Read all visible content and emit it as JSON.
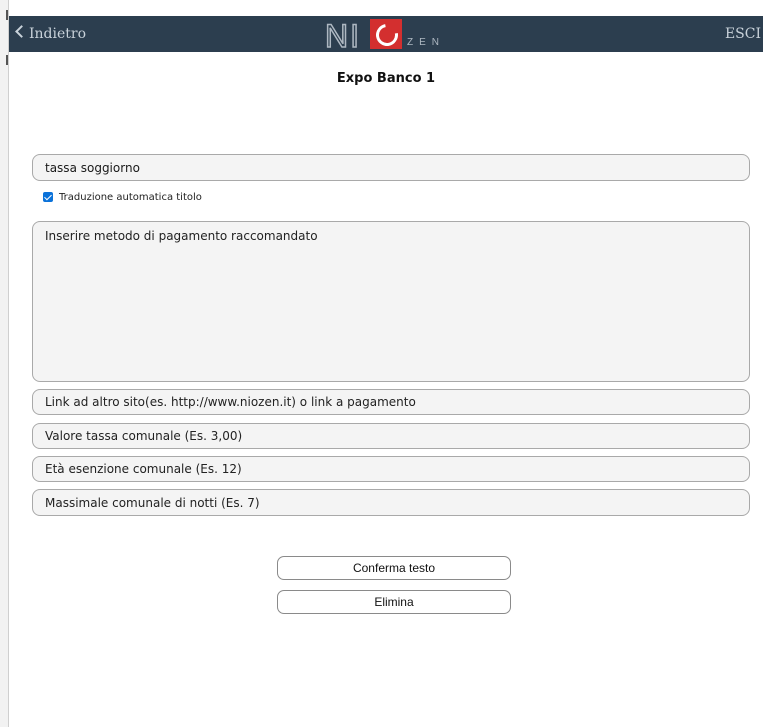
{
  "header": {
    "back_label": "Indietro",
    "logo_text_left": "NI",
    "logo_text_small": "ZEN",
    "exit_label": "ESCI",
    "bar_color": "#2c3e4f",
    "accent_color": "#d32f2f"
  },
  "page": {
    "title": "Expo Banco 1"
  },
  "form": {
    "title_value": "tassa soggiorno",
    "auto_translate_label": "Traduzione automatica titolo",
    "auto_translate_checked": true,
    "description_placeholder": "Inserire metodo di pagamento raccomandato",
    "link_placeholder": "Link ad altro sito(es. http://www.niozen.it) o link a pagamento",
    "tax_value_placeholder": "Valore tassa comunale (Es. 3,00)",
    "exemption_age_placeholder": "Età esenzione comunale (Es. 12)",
    "max_nights_placeholder": "Massimale comunale di notti (Es. 7)"
  },
  "actions": {
    "confirm_label": "Conferma testo",
    "delete_label": "Elimina"
  },
  "icons": {
    "back": "chevron-left-icon",
    "exit": "logout-icon",
    "checkbox": "checkbox-checked-icon"
  }
}
